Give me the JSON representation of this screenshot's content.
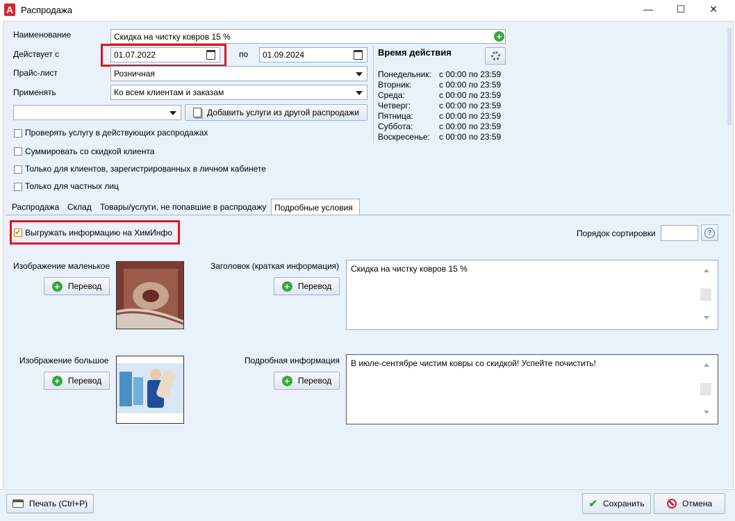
{
  "window": {
    "title": "Распродажа",
    "minimize_glyph": "—",
    "maximize_glyph": "☐",
    "close_glyph": "✕",
    "app_icon_letter": "A"
  },
  "form": {
    "name_label": "Наименование",
    "name_value": "Скидка на чистку ковров 15 %",
    "valid_from_label": "Действует с",
    "valid_from_value": "01.07.2022",
    "valid_to_label": "по",
    "valid_to_value": "01.09.2024",
    "pricelist_label": "Прайс-лист",
    "pricelist_value": "Розничная",
    "apply_label": "Применять",
    "apply_value": "Ко всем клиентам и заказам",
    "extra_select_value": "",
    "add_services_button": "Добавить услуги из другой распродажи"
  },
  "checkboxes": [
    {
      "label": "Проверять услугу в действующих распродажах",
      "checked": false
    },
    {
      "label": "Суммировать со скидкой клиента",
      "checked": false
    },
    {
      "label": "Только для клиентов, зарегистрированных в личном кабинете",
      "checked": false
    },
    {
      "label": "Только для частных лиц",
      "checked": false
    }
  ],
  "schedule": {
    "title": "Время действия",
    "days": [
      {
        "day": "Понедельник:",
        "time": "с 00:00 по 23:59"
      },
      {
        "day": "Вторник:",
        "time": "с 00:00 по 23:59"
      },
      {
        "day": "Среда:",
        "time": "с 00:00 по 23:59"
      },
      {
        "day": "Четверг:",
        "time": "с 00:00 по 23:59"
      },
      {
        "day": "Пятница:",
        "time": "с 00:00 по 23:59"
      },
      {
        "day": "Суббота:",
        "time": "с 00:00 по 23:59"
      },
      {
        "day": "Воскресенье:",
        "time": "с 00:00 по 23:59"
      }
    ]
  },
  "tabs": [
    {
      "label": "Распродажа",
      "active": false
    },
    {
      "label": "Склад",
      "active": false
    },
    {
      "label": "Товары/услуги, не попавшие в распродажу",
      "active": false
    },
    {
      "label": "Подробные условия",
      "active": true
    }
  ],
  "details": {
    "export_checkbox_label": "Выгружать информацию на ХимИнфо",
    "export_checked": true,
    "sort_order_label": "Порядок сортировки",
    "sort_order_value": "",
    "help_glyph": "?",
    "small_image_label": "Изображение маленькое",
    "large_image_label": "Изображение большое",
    "header_label": "Заголовок (краткая информация)",
    "header_value": "Скидка на чистку ковров 15 %",
    "detail_label": "Подробная информация",
    "detail_value": "В июле-сентябре чистим ковры со скидкой! Успейте почистить!",
    "translate_button": "Перевод"
  },
  "footer": {
    "print_button": "Печать (Ctrl+P)",
    "save_button": "Сохранить",
    "cancel_button": "Отмена"
  },
  "colors": {
    "accent_red": "#e3141d",
    "panel_bg": "#e9f1fb",
    "green": "#3aa641"
  }
}
